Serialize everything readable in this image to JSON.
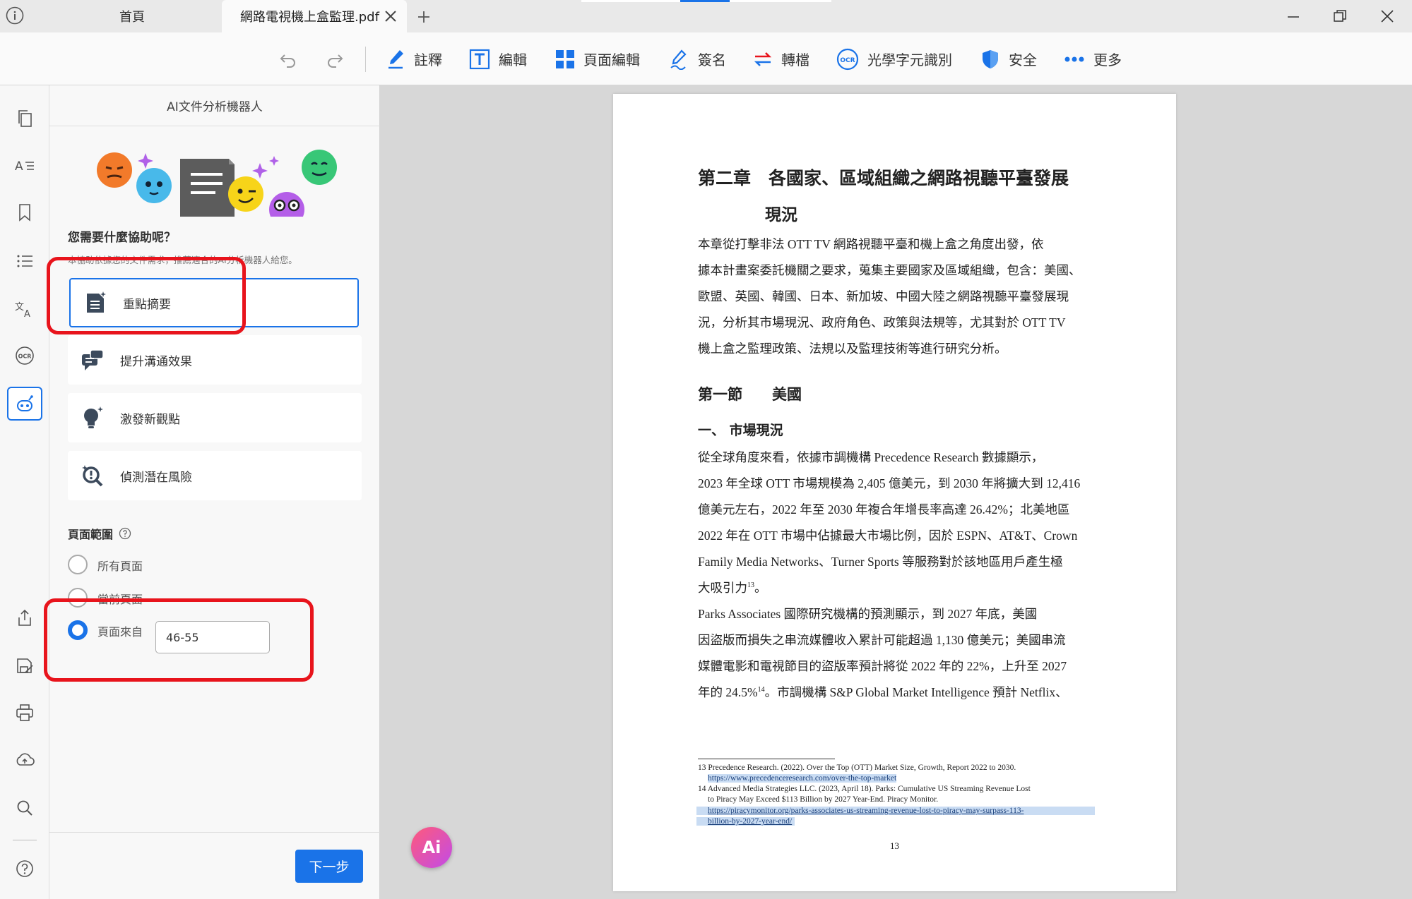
{
  "titlebar": {
    "tabs": [
      {
        "label": "首頁"
      },
      {
        "label": "網路電視機上盒監理.pdf"
      }
    ]
  },
  "toolbar": {
    "items": [
      {
        "label": "註釋",
        "icon": "pen-icon"
      },
      {
        "label": "編輯",
        "icon": "text-edit-icon"
      },
      {
        "label": "頁面編輯",
        "icon": "grid-icon"
      },
      {
        "label": "簽名",
        "icon": "signature-icon"
      },
      {
        "label": "轉檔",
        "icon": "convert-icon"
      },
      {
        "label": "光學字元識別",
        "icon": "ocr-icon"
      },
      {
        "label": "安全",
        "icon": "shield-icon"
      },
      {
        "label": "更多",
        "icon": "more-icon"
      }
    ],
    "ocr_badge": "OCR"
  },
  "panel": {
    "title": "AI文件分析機器人",
    "question": "您需要什麼協助呢？",
    "hint": "本協助依據您的文件需求，推薦適合的AI分析機器人給您。",
    "cards": [
      {
        "label": "重點摘要"
      },
      {
        "label": "提升溝通效果"
      },
      {
        "label": "激發新觀點"
      },
      {
        "label": "偵測潛在風險"
      }
    ],
    "range_title": "頁面範圍",
    "radios": [
      {
        "label": "所有頁面"
      },
      {
        "label": "當前頁面"
      },
      {
        "label": "頁面來自"
      }
    ],
    "range_value": "46-55",
    "next_label": "下一步"
  },
  "ai_badge": "Ai",
  "document": {
    "chapter_title": "第二章　各國家、區域組織之網路視聽平臺發展",
    "chapter_title_2": "現況",
    "intro": [
      "本章從打擊非法 OTT TV 網路視聽平臺和機上盒之角度出發，依",
      "據本計畫案委託機關之要求，蒐集主要國家及區域組織，包含：美國、",
      "歐盟、英國、韓國、日本、新加坡、中國大陸之網路視聽平臺發展現",
      "況，分析其市場現況、政府角色、政策與法規等，尤其對於 OTT TV",
      "機上盒之監理政策、法規以及監理技術等進行研究分析。"
    ],
    "section_title": "第一節　　美國",
    "subsection_title": "一、 市場現況",
    "para1": [
      "從全球角度來看，依據市調機構 Precedence Research 數據顯示，",
      "2023 年全球 OTT 市場規模為 2,405 億美元，到 2030 年將擴大到 12,416",
      "億美元左右，2022 年至 2030 年複合年增長率高達 26.42%；北美地區",
      "2022 年在 OTT 市場中佔據最大市場比例，因於 ESPN、AT&T、Crown",
      "Family Media Networks、Turner Sports 等服務對於該地區用戶產生極",
      "大吸引力"
    ],
    "fn_ref_13": "13",
    "para1_end": "。",
    "para2": [
      "Parks Associates 國際研究機構的預測顯示，到 2027 年底，美國",
      "因盜版而損失之串流媒體收入累計可能超過 1,130 億美元；美國串流",
      "媒體電影和電視節目的盜版率預計將從 2022 年的 22%，上升至 2027",
      "年的 24.5%"
    ],
    "fn_ref_14": "14",
    "para2_end": "。市調機構 S&P Global Market Intelligence 預計 Netflix、",
    "footnotes": [
      "13 Precedence Research. (2022). Over the Top (OTT) Market Size, Growth, Report 2022 to 2030.",
      "https://www.precedenceresearch.com/over-the-top-market",
      "14 Advanced Media Strategies LLC. (2023, April 18). Parks: Cumulative US Streaming Revenue Lost",
      "to Piracy May Exceed $113 Billion by 2027 Year-End. Piracy Monitor.",
      "https://piracymonitor.org/parks-associates-us-streaming-revenue-lost-to-piracy-may-surpass-113-",
      "billion-by-2027-year-end/"
    ],
    "page_number": "13"
  },
  "colors": {
    "accent": "#1a73e8",
    "highlight": "#e8141c",
    "link_highlight": "#c9dcf3"
  }
}
